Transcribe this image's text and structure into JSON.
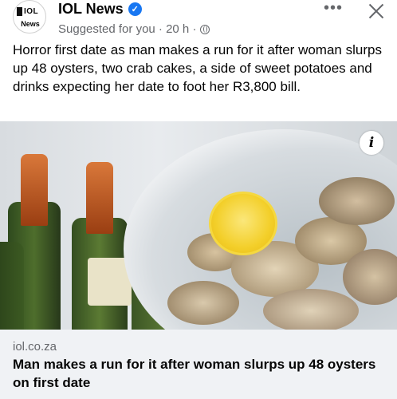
{
  "post": {
    "page_name": "IOL News",
    "avatar_text_top": "IOL",
    "avatar_text_bottom": "News",
    "meta": "Suggested for you · 20 h ·",
    "more_label": "•••",
    "close_label": "",
    "text": "Horror first date as man makes a run for it after woman slurps up 48 oysters, two crab cakes, a side of sweet potatoes and drinks expecting her date to foot her R3,800 bill."
  },
  "icons": {
    "verified": "verified-badge-icon",
    "globe": "globe-icon",
    "info": "info-icon",
    "close": "close-icon",
    "more": "more-options-icon"
  },
  "image": {
    "info_label": "i"
  },
  "link": {
    "domain": "iol.co.za",
    "title": "Man makes a run for it after woman slurps up 48 oysters on first date"
  },
  "colors": {
    "brand_blue": "#1877f2",
    "meta_gray": "#65676b",
    "link_bg": "#f0f2f5"
  }
}
